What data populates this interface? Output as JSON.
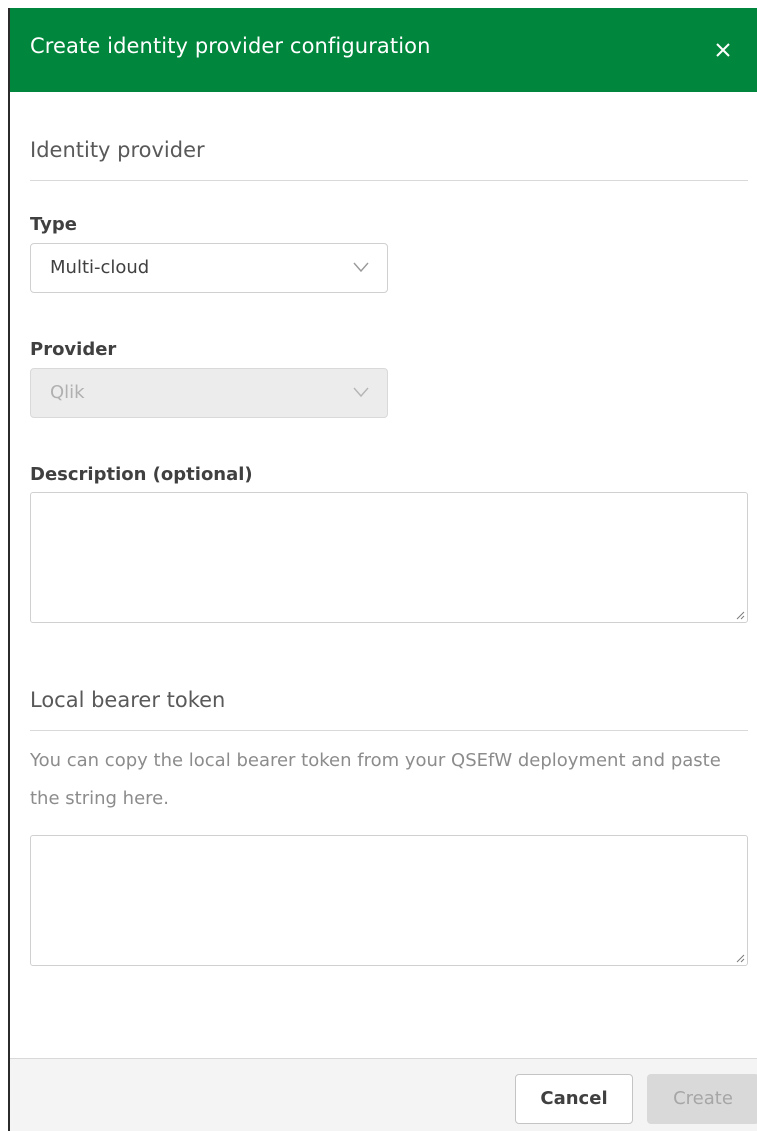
{
  "dialog": {
    "title": "Create identity provider configuration",
    "header_color": "#00873d",
    "close_icon": "close-icon"
  },
  "identity_provider": {
    "heading": "Identity provider",
    "type": {
      "label": "Type",
      "value": "Multi-cloud"
    },
    "provider": {
      "label": "Provider",
      "value": "Qlik",
      "disabled": true
    },
    "description": {
      "label": "Description (optional)",
      "value": ""
    }
  },
  "local_bearer_token": {
    "heading": "Local bearer token",
    "help_text": "You can copy the local bearer token from your QSEfW deployment and paste the string here.",
    "value": ""
  },
  "footer": {
    "cancel_label": "Cancel",
    "create_label": "Create",
    "create_disabled": true
  }
}
